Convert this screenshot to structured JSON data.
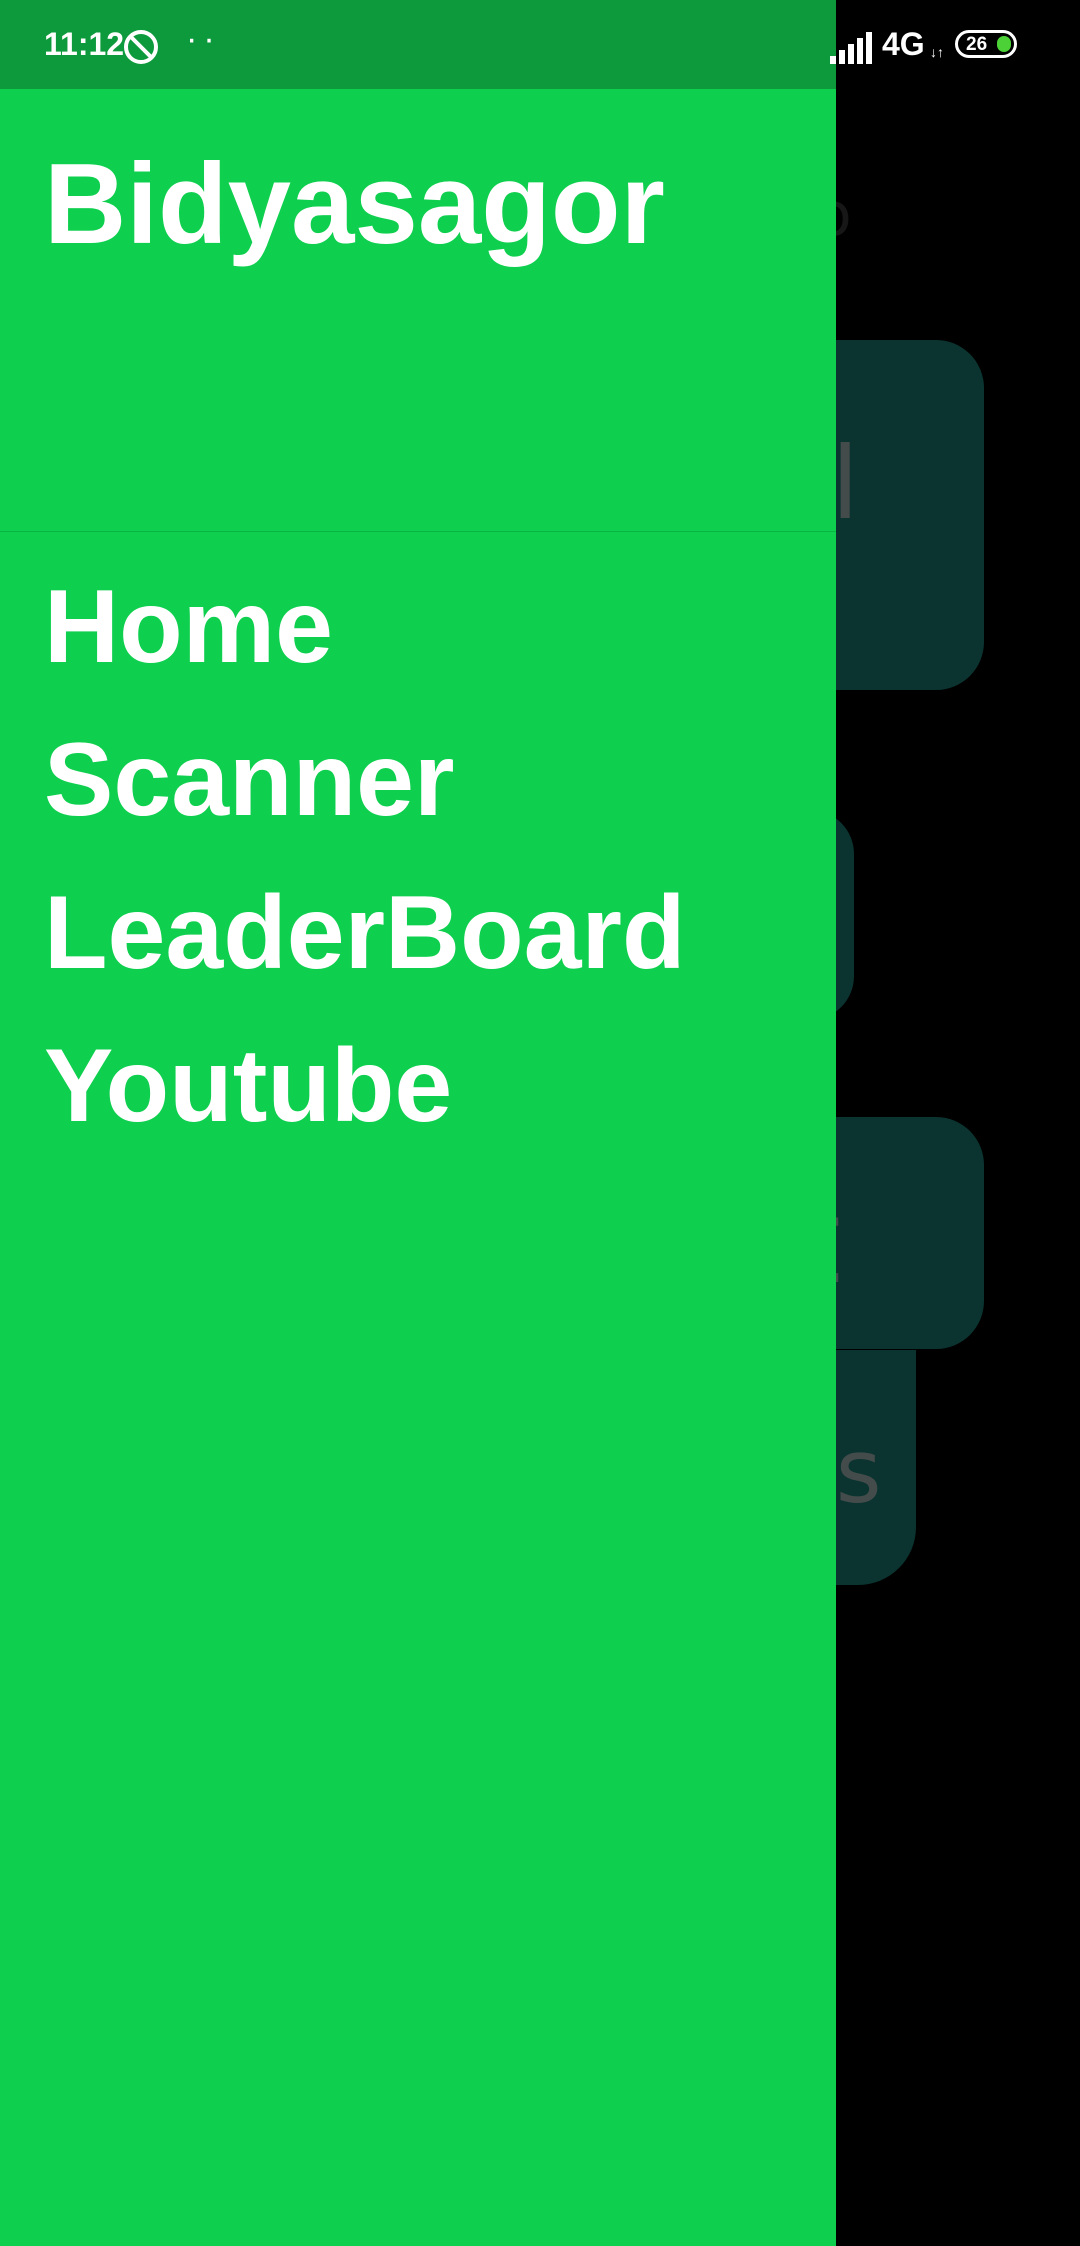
{
  "status_bar": {
    "time": "11:12",
    "dots": "··",
    "network": "4G",
    "network_arrows": "↓↑",
    "battery": "26",
    "icons": [
      "dnd-icon",
      "signal-icon",
      "battery-icon"
    ]
  },
  "drawer": {
    "title": "Bidyasagor",
    "items": [
      {
        "label": "Home"
      },
      {
        "label": "Scanner"
      },
      {
        "label": "LeaderBoard"
      },
      {
        "label": "Youtube"
      }
    ]
  },
  "background": {
    "card1_text": "al",
    "card3_text": "nt",
    "card4_text": "us"
  },
  "colors": {
    "drawer_bg": "#0ecf4e",
    "status_bar_bg": "#0d9a3c",
    "card_bg": "#145f58"
  }
}
